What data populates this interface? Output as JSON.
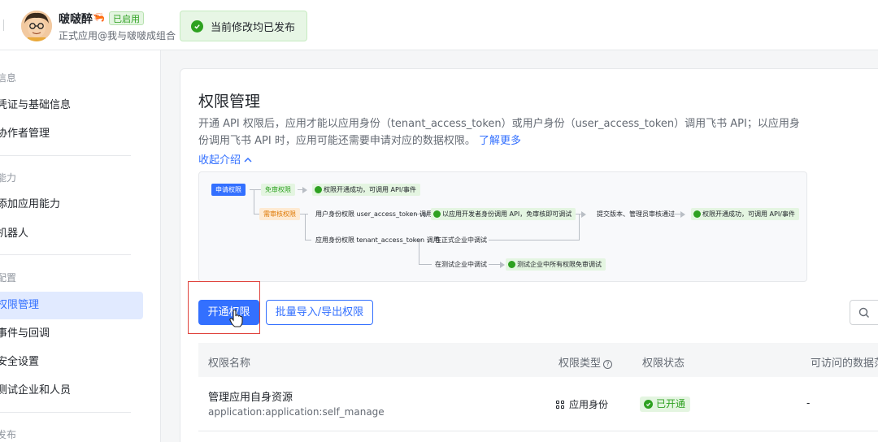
{
  "header": {
    "app_name": "啵啵醉",
    "enabled_badge": "已启用",
    "app_subtitle": "正式应用@我与啵啵成组合",
    "toast_text": "当前修改均已发布"
  },
  "sidebar": {
    "sections": [
      {
        "label": "信息"
      },
      {
        "label": "能力"
      },
      {
        "label": "配置"
      },
      {
        "label": "发布"
      }
    ],
    "items": [
      {
        "label": "凭证与基础信息"
      },
      {
        "label": "协作者管理"
      },
      {
        "label": "添加应用能力"
      },
      {
        "label": "机器人"
      },
      {
        "label": "权限管理"
      },
      {
        "label": "事件与回调"
      },
      {
        "label": "安全设置"
      },
      {
        "label": "测试企业和人员"
      }
    ]
  },
  "main": {
    "title": "权限管理",
    "desc_text": "开通 API 权限后，应用才能以应用身份（tenant_access_token）或用户身份（user_access_token）调用飞书 API；以应用身份调用飞书 API 时，应用可能还需要申请对应的数据权限。",
    "desc_link": "了解更多",
    "collapse_label": "收起介绍",
    "flow": {
      "apply": "申请权限",
      "no_review": "免审权限",
      "ok_direct": "权限开通成功，可调用 API/事件",
      "need_review": "需审核权限",
      "user_identity": "用户身份权限 user_access_token 调用",
      "dev_debug": "以应用开发者身份调用 API，免审核即可调试",
      "submit_version": "提交版本、管理员审核通过",
      "ok_final": "权限开通成功，可调用 API/事件",
      "app_identity": "应用身份权限 tenant_access_token 调用",
      "prod_debug": "在正式企业中调试",
      "test_debug": "在测试企业中调试",
      "test_free": "测试企业中所有权限免审调试"
    },
    "btn_enable": "开通权限",
    "btn_import": "批量导入/导出权限",
    "table": {
      "headers": {
        "name": "权限名称",
        "type": "权限类型",
        "status": "权限状态",
        "data": "可访问的数据范"
      },
      "rows": [
        {
          "name": "管理应用自身资源",
          "code": "application:application:self_manage",
          "type": "应用身份",
          "status": "已开通",
          "data": "-"
        }
      ]
    }
  },
  "colors": {
    "primary": "#3370ff",
    "success": "#2ea121",
    "danger": "#e0443e"
  }
}
